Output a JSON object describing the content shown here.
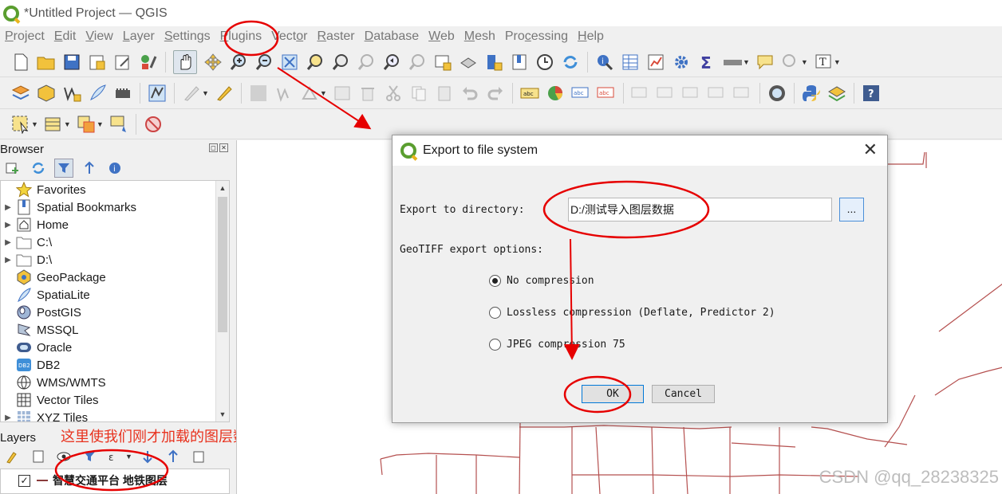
{
  "window": {
    "title": "*Untitled Project — QGIS"
  },
  "menubar": {
    "items": [
      {
        "label": "Project",
        "key": "P",
        "rest": "roject"
      },
      {
        "label": "Edit",
        "key": "E",
        "rest": "dit"
      },
      {
        "label": "View",
        "key": "V",
        "rest": "iew"
      },
      {
        "label": "Layer",
        "key": "L",
        "rest": "ayer"
      },
      {
        "label": "Settings",
        "key": "S",
        "rest": "ettings"
      },
      {
        "label": "Plugins",
        "key": "P",
        "rest": "lugins"
      },
      {
        "label": "Vector",
        "key": "o",
        "pre": "Vect",
        "post": "r"
      },
      {
        "label": "Raster",
        "key": "R",
        "rest": "aster"
      },
      {
        "label": "Database",
        "key": "D",
        "rest": "atabase"
      },
      {
        "label": "Web",
        "key": "W",
        "rest": "eb"
      },
      {
        "label": "Mesh",
        "key": "M",
        "rest": "esh"
      },
      {
        "label": "Processing",
        "key": "c",
        "pre": "Pro",
        "post": "essing"
      },
      {
        "label": "Help",
        "key": "H",
        "rest": "elp"
      }
    ]
  },
  "browser_panel": {
    "title": "Browser",
    "items": [
      {
        "label": "Favorites",
        "icon": "star-icon",
        "expandable": false
      },
      {
        "label": "Spatial Bookmarks",
        "icon": "bookmark-icon",
        "expandable": true
      },
      {
        "label": "Home",
        "icon": "home-icon",
        "expandable": true
      },
      {
        "label": "C:\\",
        "icon": "folder-icon",
        "expandable": true
      },
      {
        "label": "D:\\",
        "icon": "folder-icon",
        "expandable": true
      },
      {
        "label": "GeoPackage",
        "icon": "geopackage-icon",
        "expandable": false
      },
      {
        "label": "SpatiaLite",
        "icon": "spatialite-icon",
        "expandable": false
      },
      {
        "label": "PostGIS",
        "icon": "postgis-icon",
        "expandable": false
      },
      {
        "label": "MSSQL",
        "icon": "mssql-icon",
        "expandable": false
      },
      {
        "label": "Oracle",
        "icon": "oracle-icon",
        "expandable": false
      },
      {
        "label": "DB2",
        "icon": "db2-icon",
        "expandable": false
      },
      {
        "label": "WMS/WMTS",
        "icon": "wms-icon",
        "expandable": false
      },
      {
        "label": "Vector Tiles",
        "icon": "vector-tiles-icon",
        "expandable": false
      },
      {
        "label": "XYZ Tiles",
        "icon": "xyz-tiles-icon",
        "expandable": true
      }
    ]
  },
  "layers_panel": {
    "title": "Layers",
    "layer": {
      "name": "智慧交通平台 地铁图层",
      "checked": true,
      "check_mark": "✓"
    }
  },
  "annotation": {
    "text": "这里使我们刚才加载的图层数据",
    "color": "#e8321e"
  },
  "dialog": {
    "title": "Export to file system",
    "close_glyph": "✕",
    "directory_label": "Export to directory:",
    "directory_value": "D:/测试导入图层数据",
    "browse_label": "...",
    "options_label": "GeoTIFF export options:",
    "options": [
      {
        "label": "No compression",
        "selected": true
      },
      {
        "label": "Lossless compression (Deflate, Predictor 2)",
        "selected": false
      },
      {
        "label": "JPEG compression 75",
        "selected": false
      }
    ],
    "ok_label": "OK",
    "cancel_label": "Cancel"
  },
  "map": {
    "line_color": "#b5504f"
  },
  "watermark": {
    "text": "CSDN @qq_28238325"
  },
  "highlight_color": "#e60000"
}
